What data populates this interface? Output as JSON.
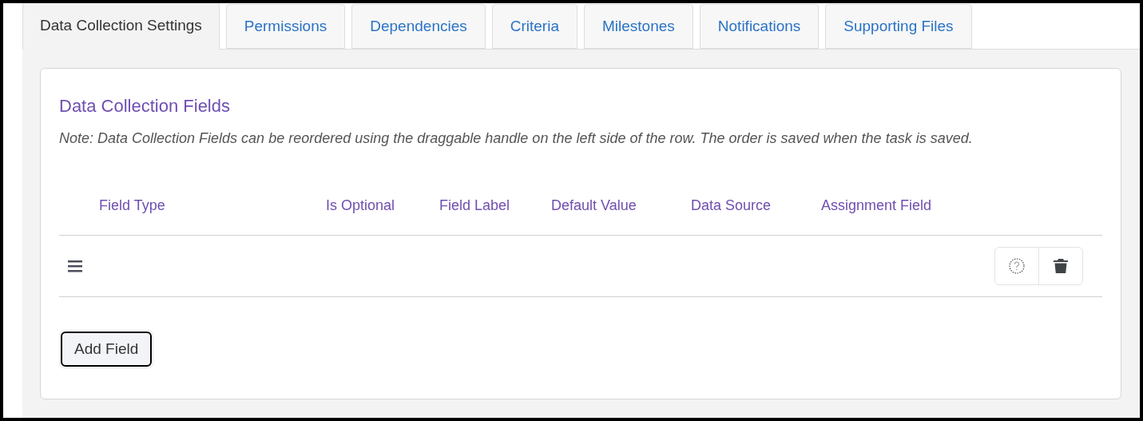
{
  "tabs": [
    {
      "label": "Data Collection Settings",
      "selected": true
    },
    {
      "label": "Permissions",
      "selected": false
    },
    {
      "label": "Dependencies",
      "selected": false
    },
    {
      "label": "Criteria",
      "selected": false
    },
    {
      "label": "Milestones",
      "selected": false
    },
    {
      "label": "Notifications",
      "selected": false
    },
    {
      "label": "Supporting Files",
      "selected": false
    }
  ],
  "card": {
    "title": "Data Collection Fields",
    "note": "Note: Data Collection Fields can be reordered using the draggable handle on the left side of the row. The order is saved when the task is saved.",
    "table": {
      "columns": [
        "Field Type",
        "Is Optional",
        "Field Label",
        "Default Value",
        "Data Source",
        "Assignment Field"
      ]
    },
    "add_button": "Add Field"
  }
}
